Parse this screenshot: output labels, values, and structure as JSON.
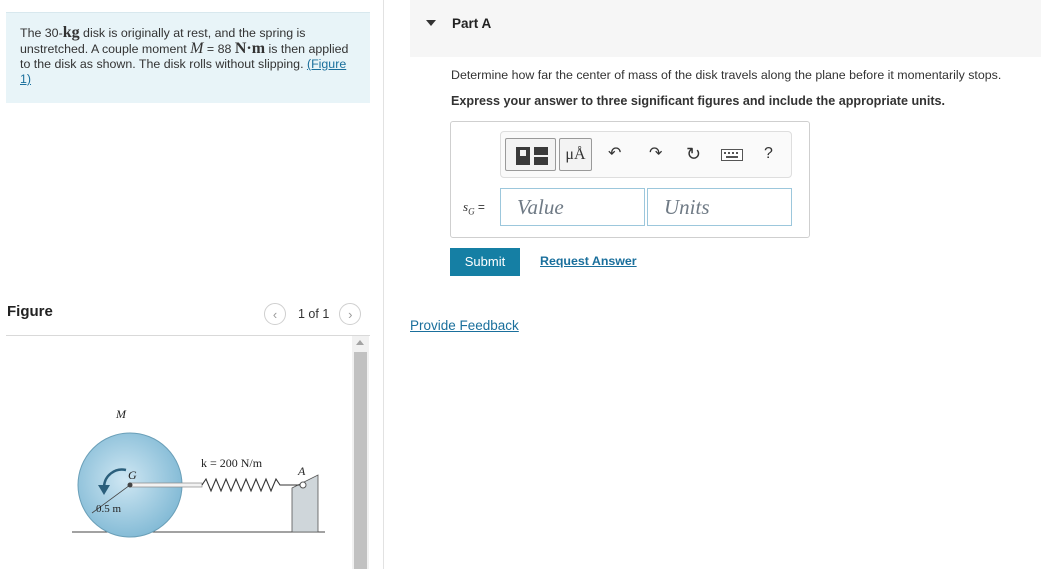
{
  "problem": {
    "text_pre": "The 30-",
    "mass_unit": "kg",
    "text_mid1": " disk is originally at rest, and the spring is unstretched. A couple moment ",
    "moment_symbol": "M",
    "moment_value": " = 88 ",
    "moment_unit": "N·m",
    "text_mid2": " is then applied to the disk as shown. The disk rolls without slipping. ",
    "figure_link": "(Figure 1)"
  },
  "figure_panel": {
    "title": "Figure",
    "count": "1 of 1",
    "prev_icon": "chevron-left-icon",
    "next_icon": "chevron-right-icon",
    "labels": {
      "moment": "M",
      "center": "G",
      "stiffness": "k = 200 N/m",
      "anchor": "A",
      "radius": "0.5 m"
    }
  },
  "part": {
    "title": "Part A",
    "question": "Determine how far the center of mass of the disk travels along the plane before it momentarily stops.",
    "instruction": "Express your answer to three significant figures and include the appropriate units."
  },
  "toolbar": {
    "icons": [
      "templates-icon",
      "units-icon",
      "undo-icon",
      "redo-icon",
      "reset-icon",
      "keyboard-icon",
      "help-icon"
    ],
    "units_label": "μÅ",
    "help_label": "?"
  },
  "answer": {
    "variable": "s",
    "subscript": "G",
    "equals": " =",
    "value_placeholder": "Value",
    "units_placeholder": "Units"
  },
  "actions": {
    "submit_label": "Submit",
    "request_label": "Request Answer",
    "feedback_label": "Provide Feedback"
  },
  "colors": {
    "accent": "#157fa4",
    "link": "#1a6f9c",
    "problem_bg": "#e8f4f8",
    "disk": "#8fc4dd",
    "field_border": "#9cc7dc"
  }
}
